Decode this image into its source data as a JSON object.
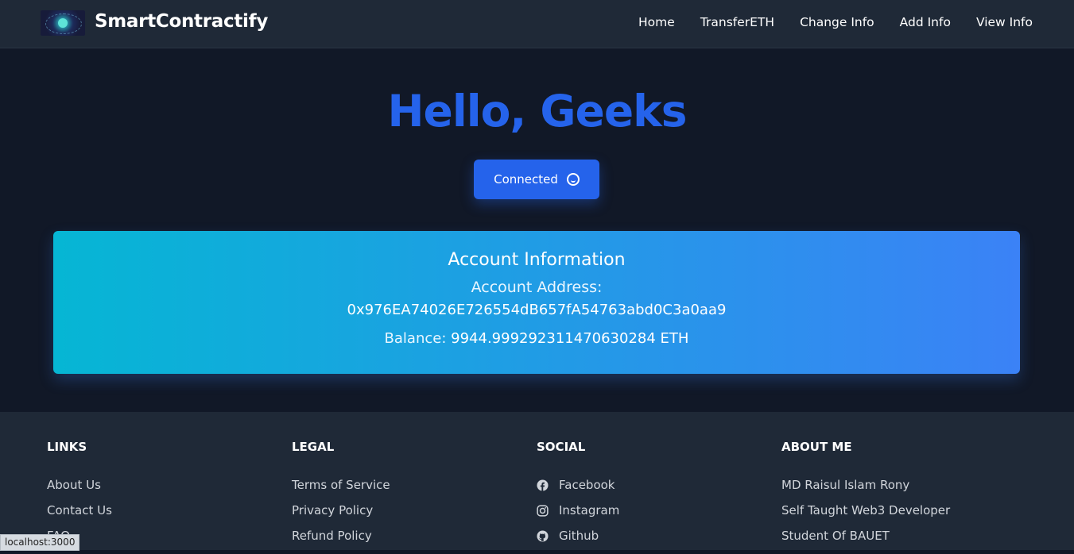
{
  "header": {
    "brand": "SmartContractify",
    "nav": [
      "Home",
      "TransferETH",
      "Change Info",
      "Add Info",
      "View Info"
    ]
  },
  "hero": {
    "title": "Hello, Geeks",
    "button_label": "Connected"
  },
  "account": {
    "title": "Account Information",
    "address_label": "Account Address:",
    "address": "0x976EA74026E726554dB657fA54763abd0C3a0aa9",
    "balance_label": "Balance:",
    "balance_value": "9944.999292311470630284 ETH"
  },
  "footer": {
    "links": {
      "heading": "LINKS",
      "items": [
        "About Us",
        "Contact Us",
        "FAQ"
      ]
    },
    "legal": {
      "heading": "LEGAL",
      "items": [
        "Terms of Service",
        "Privacy Policy",
        "Refund Policy"
      ]
    },
    "social": {
      "heading": "SOCIAL",
      "items": [
        "Facebook",
        "Instagram",
        "Github"
      ]
    },
    "about": {
      "heading": "ABOUT ME",
      "items": [
        "MD Raisul Islam Rony",
        "Self Taught Web3 Developer",
        "Student Of BAUET"
      ]
    }
  },
  "status_bar": "localhost:3000",
  "colors": {
    "accent": "#2563eb",
    "card_start": "#06b6d4",
    "card_end": "#3b82f6",
    "bg": "#111827",
    "panel": "#1f2937"
  }
}
